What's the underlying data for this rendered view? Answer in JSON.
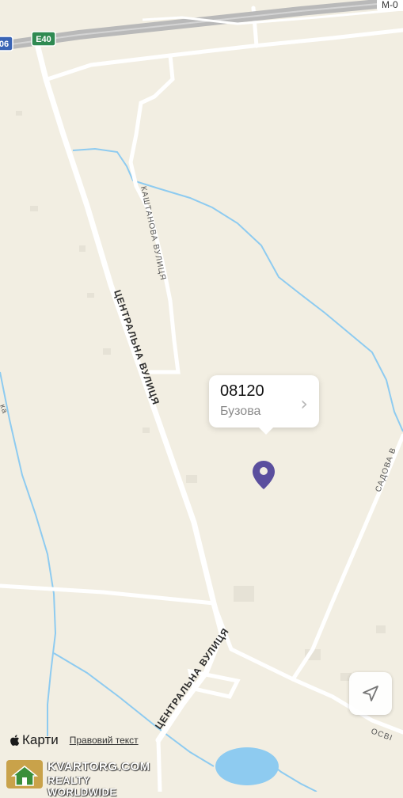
{
  "map": {
    "colors": {
      "land": "#f2eee2",
      "highway": "#b9b9b9",
      "road": "#ffffff",
      "water": "#8ecbf0",
      "pin": "#5b4f9e"
    },
    "labels": {
      "highway_shield": "E40",
      "highway_shield_left": "06",
      "highway_name": "M-0",
      "street_kashtanova": "КАШТАНОВА ВУЛИЦЯ",
      "street_tsentralna_1": "ЦЕНТРАЛЬНА ВУЛИЦЯ",
      "street_tsentralna_2": "ЦЕНТРАЛЬНА ВУЛИЦЯ",
      "street_sadova": "САДОВА В",
      "street_osvity": "ОСВІ",
      "left_edge_fragment": "ка"
    }
  },
  "callout": {
    "title": "08120",
    "subtitle": "Бузова",
    "chevron": "›"
  },
  "pin": {
    "icon": "map-pin-icon"
  },
  "locate_button": {
    "icon": "location-arrow-icon"
  },
  "attribution": {
    "brand": "Карти",
    "legal": "Правовий текст"
  },
  "watermark": {
    "line1": "KVARTORG.COM",
    "line2": "REALTY WORLDWIDE"
  }
}
